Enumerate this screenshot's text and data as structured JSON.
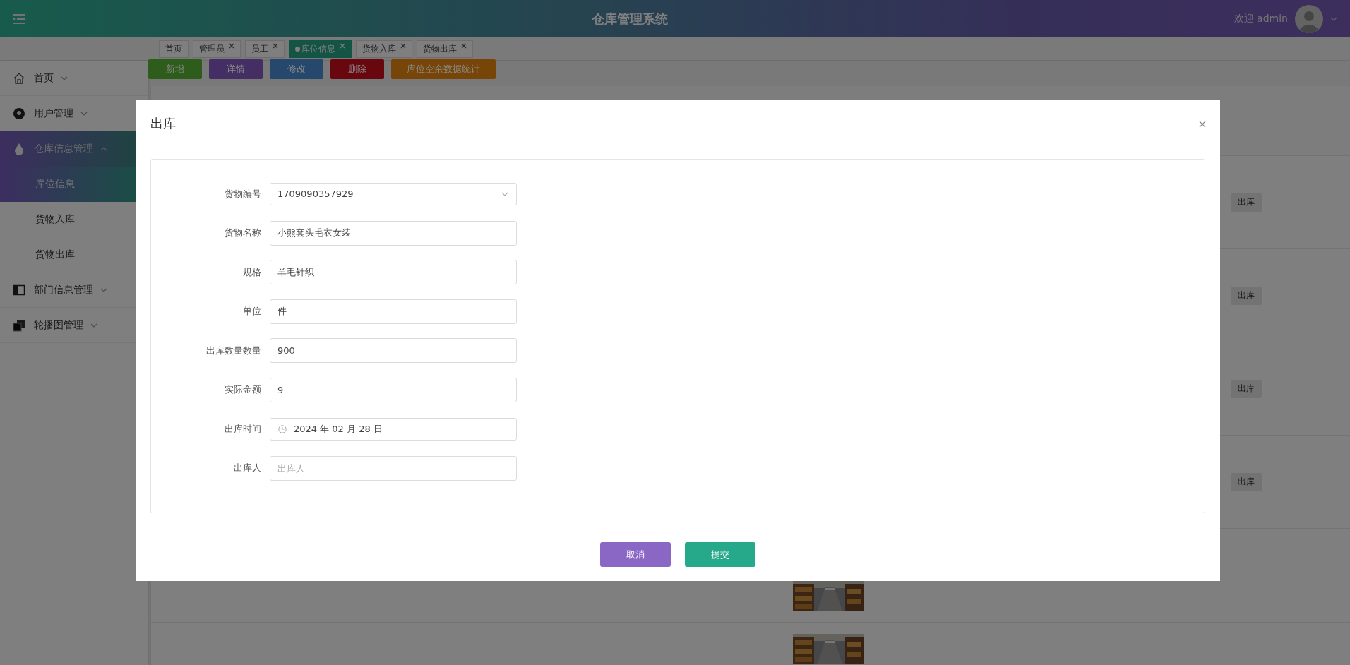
{
  "header": {
    "title": "仓库管理系统",
    "welcome": "欢迎 admin"
  },
  "tabs": [
    {
      "label": "首页",
      "closable": false,
      "selected": false
    },
    {
      "label": "管理员",
      "closable": true,
      "selected": false
    },
    {
      "label": "员工",
      "closable": true,
      "selected": false
    },
    {
      "label": "库位信息",
      "closable": true,
      "selected": true
    },
    {
      "label": "货物入库",
      "closable": true,
      "selected": false
    },
    {
      "label": "货物出库",
      "closable": true,
      "selected": false
    }
  ],
  "sidebar": {
    "items": [
      {
        "label": "首页",
        "kind": "home",
        "expanded": false
      },
      {
        "label": "用户管理",
        "kind": "user",
        "expanded": false
      },
      {
        "label": "仓库信息管理",
        "kind": "drop",
        "expanded": true,
        "children": [
          {
            "label": "库位信息",
            "selected": true
          },
          {
            "label": "货物入库",
            "selected": false
          },
          {
            "label": "货物出库",
            "selected": false
          }
        ]
      },
      {
        "label": "部门信息管理",
        "kind": "panel",
        "expanded": false
      },
      {
        "label": "轮播图管理",
        "kind": "copies",
        "expanded": false
      }
    ]
  },
  "toolbar": [
    {
      "label": "新增",
      "color": "#2e5c1a"
    },
    {
      "label": "详情",
      "color": "#452e64"
    },
    {
      "label": "修改",
      "color": "#25486c"
    },
    {
      "label": "删除",
      "color": "#68080e"
    },
    {
      "label": "库位空余数据统计",
      "color": "#784508"
    }
  ],
  "table": {
    "rows": [
      {
        "kind": "action",
        "action": "出库"
      },
      {
        "kind": "action",
        "action": "出库"
      },
      {
        "kind": "action",
        "action": "出库"
      },
      {
        "kind": "action",
        "action": "出库"
      },
      {
        "kind": "picture"
      },
      {
        "kind": "picture"
      }
    ]
  },
  "dialog": {
    "title": "出库",
    "fields": [
      {
        "label": "货物编号",
        "kind": "select",
        "value": "1709090357929"
      },
      {
        "label": "货物名称",
        "kind": "text",
        "value": "小熊套头毛衣女装"
      },
      {
        "label": "规格",
        "kind": "text",
        "value": "羊毛针织"
      },
      {
        "label": "单位",
        "kind": "text",
        "value": "件"
      },
      {
        "label": "出库数量数量",
        "kind": "text",
        "value": "900"
      },
      {
        "label": "实际金额",
        "kind": "text",
        "value": "9"
      },
      {
        "label": "出库时间",
        "kind": "date",
        "value": "2024 年 02 月 28 日"
      },
      {
        "label": "出库人",
        "kind": "text",
        "placeholder": "出库人"
      }
    ],
    "buttons": [
      {
        "label": "取消",
        "kind": "cancel"
      },
      {
        "label": "提交",
        "kind": "submit"
      }
    ]
  }
}
